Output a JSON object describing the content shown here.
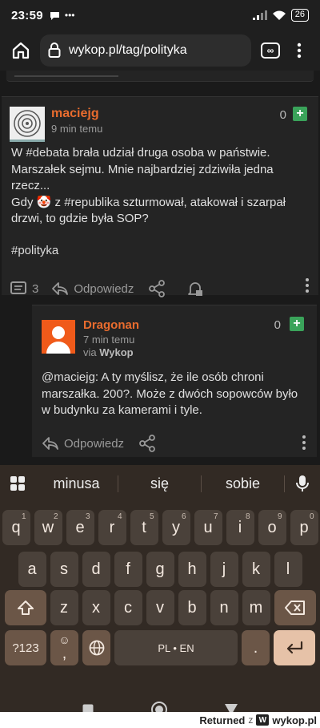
{
  "status_bar": {
    "time": "23:59",
    "battery": "26"
  },
  "browser": {
    "url": "wykop.pl/tag/polityka"
  },
  "post": {
    "username": "maciejg",
    "time": "9 min temu",
    "votes": "0",
    "plus": "+",
    "line1_a": "W ",
    "line1_tag": "#debata",
    "line1_b": " brała udział druga osoba w państwie. Marszałek sejmu. Mnie najbardziej zdziwiła jedna rzecz...",
    "line2_a": "Gdy ",
    "line2_emoji": "🤡",
    "line2_b": " z ",
    "line2_tag": "#republika",
    "line2_c": " szturmował, atakował i szarpał drzwi, to gdzie była SOP?",
    "tag": "#polityka",
    "comments": "3",
    "reply_label": "Odpowiedz"
  },
  "reply": {
    "username": "Dragonan",
    "time": "7 min temu",
    "via_prefix": "via ",
    "via_app": "Wykop",
    "votes": "0",
    "plus": "+",
    "mention": "@maciejg",
    "body": ": A ty myślisz, że ile osób chroni marszałka. 200?. Może z dwóch sopowców było w budynku za kamerami i tyle.",
    "reply_label": "Odpowiedz"
  },
  "keyboard": {
    "suggestions": [
      "minusa",
      "się",
      "sobie"
    ],
    "row1": [
      {
        "k": "q",
        "s": "1"
      },
      {
        "k": "w",
        "s": "2"
      },
      {
        "k": "e",
        "s": "3"
      },
      {
        "k": "r",
        "s": "4"
      },
      {
        "k": "t",
        "s": "5"
      },
      {
        "k": "y",
        "s": "6"
      },
      {
        "k": "u",
        "s": "7"
      },
      {
        "k": "i",
        "s": "8"
      },
      {
        "k": "o",
        "s": "9"
      },
      {
        "k": "p",
        "s": "0"
      }
    ],
    "row2": [
      "a",
      "s",
      "d",
      "f",
      "g",
      "h",
      "j",
      "k",
      "l"
    ],
    "row3": [
      "z",
      "x",
      "c",
      "v",
      "b",
      "n",
      "m"
    ],
    "symbols": "?123",
    "comma": ",",
    "space": "PL • EN",
    "period": "."
  },
  "footer": {
    "returned": "Returned",
    "z": "z",
    "site": "wykop.pl",
    "logo": "W"
  },
  "colors": {
    "accent": "#e96c2e",
    "plus": "#3aa35a",
    "keyboard_bg": "#322a24"
  }
}
